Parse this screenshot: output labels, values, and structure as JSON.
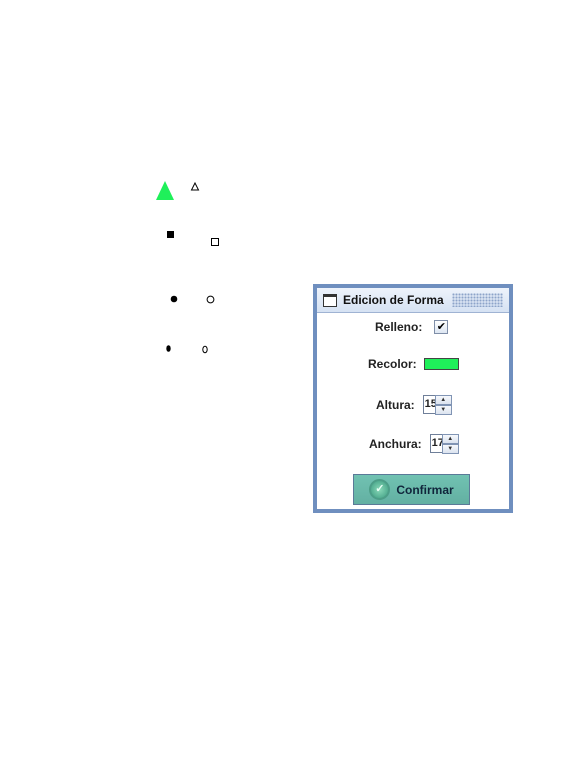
{
  "dialog": {
    "title": "Edicion de Forma",
    "relleno_label": "Relleno:",
    "relleno_checked": true,
    "relleno_mark": "✔",
    "recolor_label": "Recolor:",
    "recolor_color": "#1ff05a",
    "altura_label": "Altura:",
    "altura_value": "15",
    "anchura_label": "Anchura:",
    "anchura_value": "17",
    "confirm_label": "Confirmar",
    "spin_up": "▲",
    "spin_down": "▼",
    "confirm_icon": "✓"
  },
  "colors": {
    "shape_fill": "#1ff05a",
    "dialog_border": "#6f8fbf",
    "confirm_bg": "#6bbcac"
  },
  "shapes": [
    "filled-triangle",
    "outline-triangle",
    "filled-square",
    "outline-square",
    "filled-circle",
    "outline-circle",
    "filled-ellipse",
    "outline-ellipse"
  ]
}
